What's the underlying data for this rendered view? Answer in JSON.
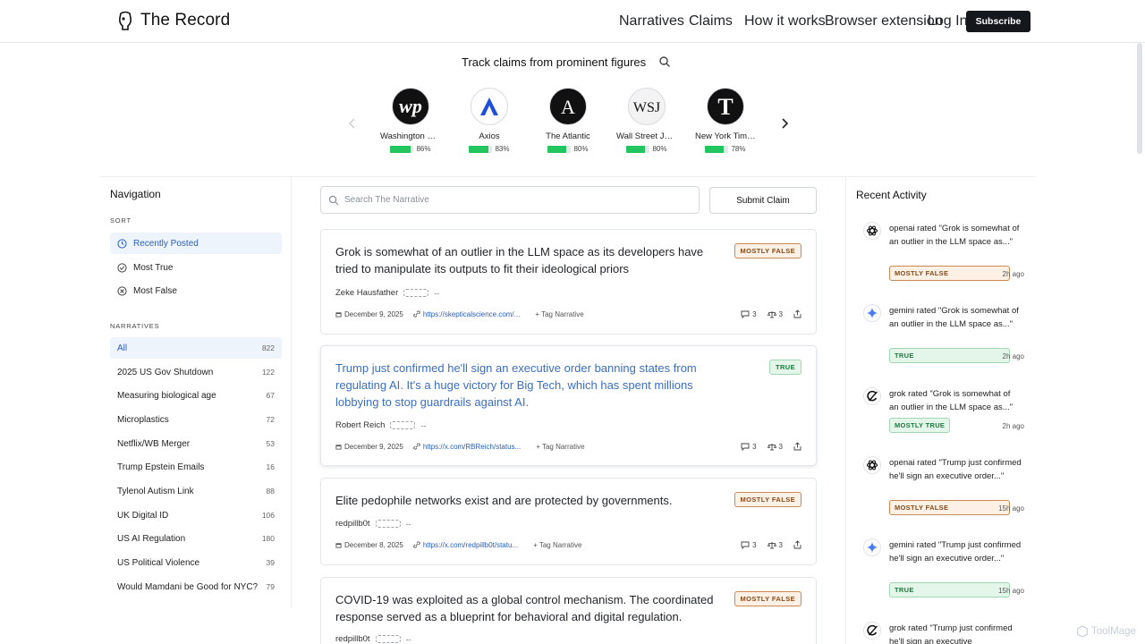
{
  "header": {
    "brand": "The Record",
    "nav": [
      "Narratives",
      "Claims",
      "How it works",
      "Browser extension",
      "Log In"
    ],
    "subscribe": "Subscribe"
  },
  "tracker": {
    "title": "Track claims from prominent figures",
    "publishers": [
      {
        "name": "Washington Post",
        "score": "86%",
        "fill": 0.86
      },
      {
        "name": "Axios",
        "score": "83%",
        "fill": 0.83
      },
      {
        "name": "The Atlantic",
        "score": "80%",
        "fill": 0.8
      },
      {
        "name": "Wall Street Journal",
        "score": "80%",
        "fill": 0.8
      },
      {
        "name": "New York Times",
        "score": "78%",
        "fill": 0.78
      }
    ]
  },
  "sidebar": {
    "title": "Navigation",
    "sort_label": "SORT",
    "sort": [
      "Recently Posted",
      "Most True",
      "Most False"
    ],
    "narratives_label": "NARRATIVES",
    "narratives": [
      {
        "label": "All",
        "count": "822"
      },
      {
        "label": "2025 US Gov Shutdown",
        "count": "122"
      },
      {
        "label": "Measuring biological age",
        "count": "67"
      },
      {
        "label": "Microplastics",
        "count": "72"
      },
      {
        "label": "Netflix/WB Merger",
        "count": "53"
      },
      {
        "label": "Trump Epstein Emails",
        "count": "16"
      },
      {
        "label": "Tylenol Autism Link",
        "count": "88"
      },
      {
        "label": "UK Digital ID",
        "count": "106"
      },
      {
        "label": "US AI Regulation",
        "count": "180"
      },
      {
        "label": "US Political Violence",
        "count": "39"
      },
      {
        "label": "Would Mamdani be Good for NYC?",
        "count": "79"
      }
    ]
  },
  "main": {
    "search_placeholder": "Search The Narrative",
    "submit": "Submit Claim",
    "tag_label": "+ Tag Narrative",
    "cards": [
      {
        "title": "Grok is somewhat of an outlier in the LLM space as its developers have tried to manipulate its outputs to fit their ideological priors",
        "verdict": "MOSTLY FALSE",
        "author": "Zeke Hausfather",
        "author_dash": "--",
        "date": "December 9, 2025",
        "link": "https://skepticalscience.com/...",
        "comments": "3",
        "ratings": "3"
      },
      {
        "title": "Trump just confirmed he'll sign an executive order banning states from regulating AI. It's a huge victory for Big Tech, which has spent millions lobbying to stop guardrails against AI.",
        "verdict": "TRUE",
        "author": "Robert Reich",
        "author_dash": "--",
        "date": "December 9, 2025",
        "link": "https://x.com/RBReich/status...",
        "comments": "3",
        "ratings": "3"
      },
      {
        "title": "Elite pedophile networks exist and are protected by governments.",
        "verdict": "MOSTLY FALSE",
        "author": "redpillb0t",
        "author_dash": "--",
        "date": "December 8, 2025",
        "link": "https://x.com/redpillb0t/statu...",
        "comments": "3",
        "ratings": "3"
      },
      {
        "title": "COVID-19 was exploited as a global control mechanism. The coordinated response served as a blueprint for behavioral and digital regulation.",
        "verdict": "MOSTLY FALSE",
        "author": "redpillb0t",
        "author_dash": "--"
      }
    ]
  },
  "activity": {
    "title": "Recent Activity",
    "items": [
      {
        "model": "openai",
        "text": "openai rated \"Grok is somewhat of an outlier in the LLM space as...\"",
        "badge": "MOSTLY FALSE",
        "time": "2h ago"
      },
      {
        "model": "gemini",
        "text": "gemini rated \"Grok is somewhat of an outlier in the LLM space as...\"",
        "badge": "TRUE",
        "time": "2h ago"
      },
      {
        "model": "grok",
        "text": "grok rated \"Grok is somewhat of an outlier in the LLM space as...\"",
        "badge": "MOSTLY TRUE",
        "time": "2h ago"
      },
      {
        "model": "openai",
        "text": "openai rated \"Trump just confirmed he'll sign an executive order...\"",
        "badge": "MOSTLY FALSE",
        "time": "15h ago"
      },
      {
        "model": "gemini",
        "text": "gemini rated \"Trump just confirmed he'll sign an executive order...\"",
        "badge": "TRUE",
        "time": "15h ago"
      },
      {
        "model": "grok",
        "text": "grok rated \"Trump just confirmed he'll sign an executive",
        "badge": "",
        "time": ""
      }
    ]
  },
  "watermark": "ToolMage",
  "colors": {
    "accent": "#2b5fb8",
    "true_green": "#22c55e",
    "false_orange": "#c98a55"
  }
}
